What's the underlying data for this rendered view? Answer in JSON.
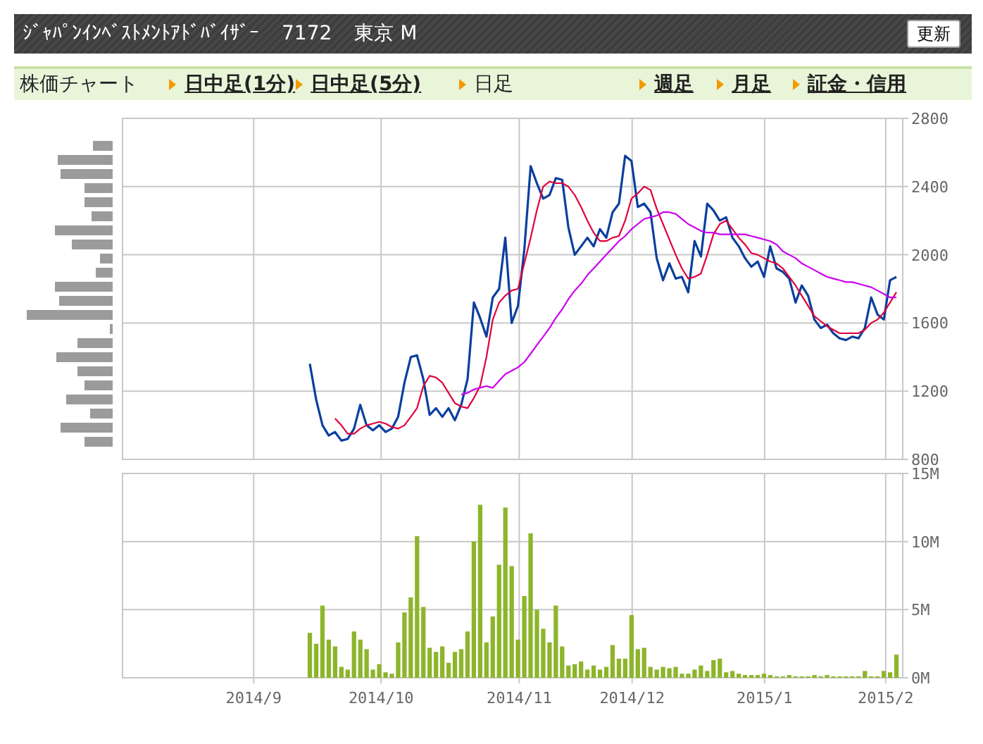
{
  "header": {
    "company": "ｼﾞｬﾊﾟﾝｲﾝﾍﾞｽﾄﾒﾝﾄｱﾄﾞﾊﾞｲｻﾞｰ",
    "code": "7172",
    "market": "東京 M",
    "refresh_button": "更新"
  },
  "page_title": "株価チャート",
  "tabs": [
    {
      "label": "日中足(1分)",
      "selected": false
    },
    {
      "label": "日中足(5分)",
      "selected": false
    },
    {
      "label": "日足",
      "selected": true
    },
    {
      "label": "週足",
      "selected": false
    },
    {
      "label": "月足",
      "selected": false
    },
    {
      "label": "証金・信用",
      "selected": false
    }
  ],
  "price_chart": {
    "chart_data": {
      "type": "line",
      "ylim": [
        800,
        2800
      ],
      "yticks": [
        800,
        1200,
        1600,
        2000,
        2400,
        2800
      ],
      "grid": true,
      "series": [
        {
          "color": "#0b3f9e",
          "values": [
            1360,
            1150,
            1000,
            940,
            960,
            910,
            920,
            980,
            1120,
            1000,
            970,
            1000,
            960,
            980,
            1050,
            1250,
            1400,
            1410,
            1270,
            1060,
            1100,
            1050,
            1100,
            1030,
            1120,
            1270,
            1720,
            1630,
            1520,
            1750,
            1800,
            2100,
            1600,
            1700,
            2030,
            2520,
            2420,
            2330,
            2350,
            2450,
            2440,
            2160,
            2000,
            2050,
            2100,
            2050,
            2150,
            2100,
            2250,
            2300,
            2580,
            2550,
            2280,
            2300,
            2250,
            1980,
            1850,
            1950,
            1860,
            1870,
            1780,
            2080,
            1990,
            2300,
            2260,
            2200,
            2220,
            2100,
            2050,
            1980,
            1930,
            1960,
            1870,
            2050,
            1920,
            1900,
            1860,
            1720,
            1820,
            1760,
            1620,
            1570,
            1590,
            1540,
            1510,
            1500,
            1520,
            1510,
            1570,
            1750,
            1650,
            1620,
            1850,
            1870
          ]
        },
        {
          "color": "#e0003c",
          "values": [
            null,
            null,
            null,
            null,
            1040,
            1000,
            950,
            950,
            980,
            1000,
            1010,
            1020,
            1010,
            990,
            980,
            1000,
            1050,
            1100,
            1230,
            1290,
            1280,
            1250,
            1190,
            1130,
            1110,
            1100,
            1160,
            1230,
            1400,
            1620,
            1720,
            1760,
            1790,
            1800,
            1950,
            2100,
            2260,
            2400,
            2430,
            2420,
            2420,
            2400,
            2350,
            2280,
            2200,
            2130,
            2080,
            2080,
            2100,
            2110,
            2200,
            2330,
            2360,
            2400,
            2380,
            2270,
            2180,
            2090,
            2000,
            1920,
            1860,
            1870,
            1890,
            2000,
            2120,
            2180,
            2200,
            2150,
            2100,
            2060,
            2010,
            2000,
            1980,
            1960,
            1950,
            1920,
            1870,
            1820,
            1760,
            1700,
            1640,
            1610,
            1580,
            1560,
            1540,
            1540,
            1540,
            1540,
            1560,
            1600,
            1620,
            1660,
            1720,
            1780
          ]
        },
        {
          "color": "#cc00ee",
          "values": [
            null,
            null,
            null,
            null,
            null,
            null,
            null,
            null,
            null,
            null,
            null,
            null,
            null,
            null,
            null,
            null,
            null,
            null,
            null,
            null,
            null,
            null,
            null,
            null,
            1180,
            1190,
            1210,
            1220,
            1230,
            1220,
            1260,
            1300,
            1320,
            1340,
            1370,
            1420,
            1470,
            1520,
            1570,
            1630,
            1680,
            1740,
            1790,
            1830,
            1880,
            1920,
            1960,
            2000,
            2040,
            2080,
            2110,
            2150,
            2180,
            2210,
            2220,
            2230,
            2250,
            2250,
            2240,
            2210,
            2180,
            2160,
            2140,
            2130,
            2130,
            2120,
            2120,
            2120,
            2120,
            2120,
            2110,
            2100,
            2090,
            2080,
            2060,
            2020,
            2000,
            1980,
            1950,
            1930,
            1910,
            1890,
            1870,
            1860,
            1850,
            1840,
            1840,
            1830,
            1820,
            1810,
            1790,
            1770,
            1750,
            1750
          ]
        }
      ]
    }
  },
  "date_labels": [
    "2014/9",
    "2014/10",
    "2014/11",
    "2014/12",
    "2015/1",
    "2015/2"
  ],
  "volume_chart": {
    "chart_data": {
      "type": "bar",
      "ylim": [
        0,
        15
      ],
      "grid": true,
      "yticks": [
        {
          "value": 0,
          "label": "0M"
        },
        {
          "value": 5,
          "label": "5M"
        },
        {
          "value": 10,
          "label": "10M"
        },
        {
          "value": 15,
          "label": "15M"
        }
      ],
      "series": [
        {
          "color": "#8db52b",
          "values": [
            3.3,
            2.5,
            5.3,
            2.8,
            2.3,
            0.8,
            0.6,
            3.4,
            2.8,
            2.1,
            0.6,
            1.0,
            0.4,
            0.3,
            2.6,
            4.8,
            5.9,
            10.4,
            5.2,
            2.2,
            1.9,
            2.3,
            1.1,
            1.9,
            2.1,
            3.4,
            10.0,
            12.7,
            2.6,
            4.5,
            8.3,
            12.5,
            8.2,
            2.8,
            6.0,
            10.6,
            5.0,
            3.6,
            2.6,
            5.3,
            2.3,
            0.9,
            1.0,
            1.2,
            0.6,
            0.9,
            0.6,
            0.8,
            2.4,
            1.4,
            1.4,
            4.6,
            2.1,
            2.2,
            0.8,
            0.6,
            0.8,
            0.7,
            0.8,
            0.3,
            0.3,
            0.6,
            0.9,
            0.5,
            1.3,
            1.4,
            0.4,
            0.5,
            0.3,
            0.2,
            0.2,
            0.2,
            0.3,
            0.2,
            0.1,
            0.1,
            0.2,
            0.1,
            0.1,
            0.1,
            0.2,
            0.1,
            0.2,
            0.1,
            0.1,
            0.1,
            0.1,
            0.1,
            0.5,
            0.1,
            0.1,
            0.5,
            0.4,
            1.7
          ]
        }
      ]
    }
  }
}
